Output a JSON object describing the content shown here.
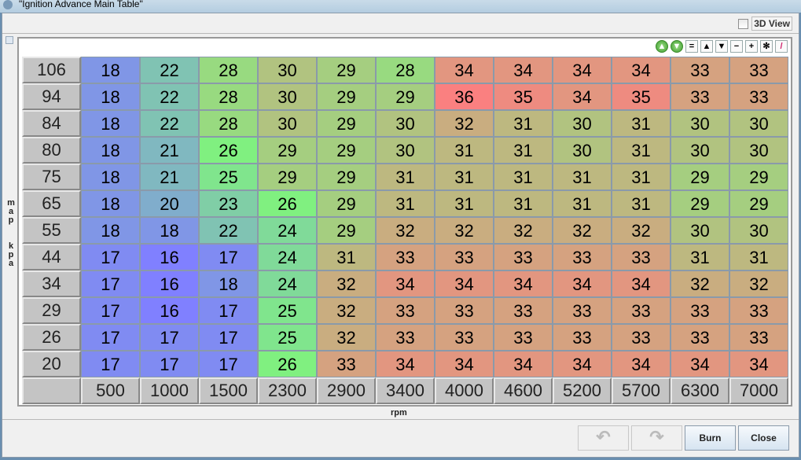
{
  "window": {
    "title": "\"Ignition Advance Main Table\""
  },
  "toolbar": {
    "view3d_label": "3D View",
    "view3d_checked": false,
    "buttons": [
      {
        "name": "increment-green-icon",
        "g": "▲"
      },
      {
        "name": "decrement-green-icon",
        "g": "▼"
      },
      {
        "name": "set-equal-button",
        "g": "="
      },
      {
        "name": "increase-button",
        "g": "▲"
      },
      {
        "name": "decrease-button",
        "g": "▼"
      },
      {
        "name": "subtract-button",
        "g": "−"
      },
      {
        "name": "add-button",
        "g": "+"
      },
      {
        "name": "multiply-button",
        "g": "✻"
      },
      {
        "name": "color-pen-button",
        "g": "/"
      }
    ]
  },
  "axes": {
    "ylabel": "map kpa",
    "xlabel": "rpm",
    "y": [
      "106",
      "94",
      "84",
      "80",
      "75",
      "65",
      "55",
      "44",
      "34",
      "29",
      "26",
      "20"
    ],
    "x": [
      "500",
      "1000",
      "1500",
      "2300",
      "2900",
      "3400",
      "4000",
      "4600",
      "5200",
      "5700",
      "6300",
      "7000"
    ]
  },
  "table": [
    [
      18,
      22,
      28,
      30,
      29,
      28,
      34,
      34,
      34,
      34,
      33,
      33
    ],
    [
      18,
      22,
      28,
      30,
      29,
      29,
      36,
      35,
      34,
      35,
      33,
      33
    ],
    [
      18,
      22,
      28,
      30,
      29,
      30,
      32,
      31,
      30,
      31,
      30,
      30
    ],
    [
      18,
      21,
      26,
      29,
      29,
      30,
      31,
      31,
      30,
      31,
      30,
      30
    ],
    [
      18,
      21,
      25,
      29,
      29,
      31,
      31,
      31,
      31,
      31,
      29,
      29
    ],
    [
      18,
      20,
      23,
      26,
      29,
      31,
      31,
      31,
      31,
      31,
      29,
      29
    ],
    [
      18,
      18,
      22,
      24,
      29,
      32,
      32,
      32,
      32,
      32,
      30,
      30
    ],
    [
      17,
      16,
      17,
      24,
      31,
      33,
      33,
      33,
      33,
      33,
      31,
      31
    ],
    [
      17,
      16,
      18,
      24,
      32,
      34,
      34,
      34,
      34,
      34,
      32,
      32
    ],
    [
      17,
      16,
      17,
      25,
      32,
      33,
      33,
      33,
      33,
      33,
      33,
      33
    ],
    [
      17,
      17,
      17,
      25,
      32,
      33,
      33,
      33,
      33,
      33,
      33,
      33
    ],
    [
      17,
      17,
      17,
      26,
      33,
      34,
      34,
      34,
      34,
      34,
      34,
      34
    ]
  ],
  "colors": {
    "low": "#7f7fff",
    "mid": "#80f080",
    "high": "#ff7f7f"
  },
  "buttons": {
    "undo": "↶",
    "redo": "↷",
    "burn": "Burn",
    "close": "Close"
  }
}
